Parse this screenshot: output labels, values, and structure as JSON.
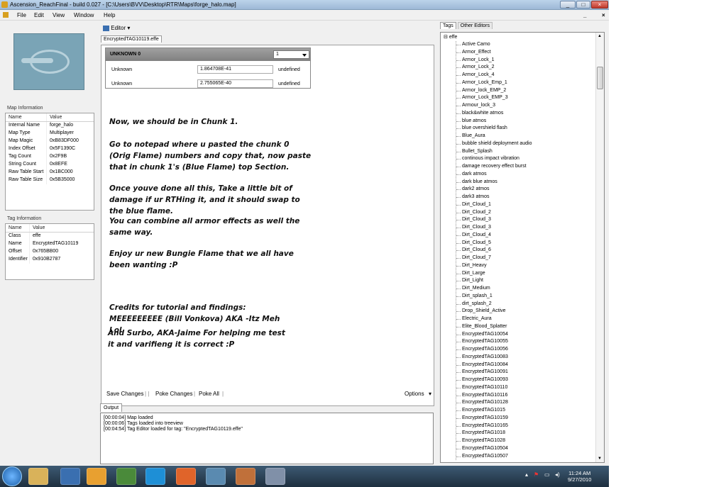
{
  "window": {
    "title": "Ascension_ReachFinal - build 0.027 - [C:\\Users\\BVV\\Desktop\\RTR\\Maps\\forge_halo.map]"
  },
  "menubar": {
    "items": [
      "File",
      "Edit",
      "View",
      "Window",
      "Help"
    ],
    "right_controls": [
      "_",
      "×"
    ]
  },
  "map_info": {
    "group_label": "Map Information",
    "headers": [
      "Name",
      "Value"
    ],
    "rows": [
      [
        "Internal Name",
        "forge_halo"
      ],
      [
        "Map Type",
        "Multiplayer"
      ],
      [
        "Map Magic",
        "0xB83DF000"
      ],
      [
        "Index Offset",
        "0x5F1390C"
      ],
      [
        "Tag Count",
        "0x2F9B"
      ],
      [
        "String Count",
        "0x8EFE"
      ],
      [
        "Raw Table Start",
        "0x1BC000"
      ],
      [
        "Raw Table Size",
        "0x5B35000"
      ]
    ]
  },
  "tag_info": {
    "group_label": "Tag Information",
    "headers": [
      "Name",
      "Value"
    ],
    "rows": [
      [
        "Class",
        "effe"
      ],
      [
        "Name",
        "EncryptedTAG10119"
      ],
      [
        "Offset",
        "0x765BB00"
      ],
      [
        "Identifier",
        "0x910B2787"
      ]
    ]
  },
  "editor": {
    "toolbar_label": "Editor",
    "tab_label": "EncryptedTAG10119.effe",
    "block_title": "UNKNOWN 0",
    "chunk_select": "1",
    "fields": [
      {
        "label": "Unknown",
        "value": "1.864708E-41",
        "type": "undefined"
      },
      {
        "label": "Unknown",
        "value": "2.755065E-40",
        "type": "undefined"
      }
    ],
    "notes": [
      "Now, we should be in Chunk 1.",
      " Go to notepad where u pasted the chunk 0 (Orig Flame) numbers and copy that, now paste that in chunk 1's (Blue Flame) top Section.",
      "Once youve done all this, Take a little bit of damage if ur RTHing it, and it should swap to the blue flame.",
      "You can combine all armor effects as well the same way.",
      "Enjoy ur new Bungie Flame that we all have been wanting :P",
      "Credits for tutorial and findings: MEEEEEEEEE (Bill Vonkova) AKA -Itz Meh Lol",
      "And Surbo, AKA-Jaime For helping me test it and varifieng it is correct :P"
    ],
    "bottom": {
      "save": "Save Changes",
      "poke": "Poke Changes",
      "poke_all": "Poke All",
      "options": "Options"
    }
  },
  "output": {
    "tab_label": "Output",
    "lines": [
      "[00:00:04] Map loaded",
      "[00:00:06] Tags loaded into treeview",
      "[00:04:54] Tag Editor loaded for tag: \"EncryptedTAG10119.effe\""
    ]
  },
  "tags_panel": {
    "tabs": [
      "Tags",
      "Other Editors"
    ],
    "root": "effe",
    "items": [
      "Active Camo",
      "Armor_Effect",
      "Armor_Lock_1",
      "Armor_Lock_2",
      "Armor_Lock_4",
      "Armor_Lock_Emp_1",
      "Armor_lock_EMP_2",
      "Armor_Lock_EMP_3",
      "Armour_lock_3",
      "black&white atmos",
      "blue atmos",
      "blue overshield flash",
      "Blue_Aura",
      "bubble shield deployment audio",
      "Bullet_Splash",
      "continous impact vibration",
      "damage recovery effect burst",
      "dark atmos",
      "dark blue atmos",
      "dark2 atmos",
      "dark3 atmos",
      "Dirt_Cloud_1",
      "Dirt_Cloud_2",
      "Dirt_Cloud_3",
      "Dirt_Cloud_3",
      "Dirt_Cloud_4",
      "Dirt_Cloud_5",
      "Dirt_Cloud_6",
      "Dirt_Cloud_7",
      "Dirt_Heavy",
      "Dirt_Large",
      "Dirt_Light",
      "Dirt_Medium",
      "Dirt_splash_1",
      "dirt_splash_2",
      "Drop_Shield_Active",
      "Electric_Aura",
      "Elite_Blood_Splatter",
      "EncryptedTAG10054",
      "EncryptedTAG10055",
      "EncryptedTAG10056",
      "EncryptedTAG10083",
      "EncryptedTAG10084",
      "EncryptedTAG10091",
      "EncryptedTAG10093",
      "EncryptedTAG10110",
      "EncryptedTAG10116",
      "EncryptedTAG10128",
      "EncryptedTAG1015",
      "EncryptedTAG10159",
      "EncryptedTAG10165",
      "EncryptedTAG1018",
      "EncryptedTAG1028",
      "EncryptedTAG10504",
      "EncryptedTAG10507"
    ]
  },
  "taskbar": {
    "time": "11:24 AM",
    "date": "9/27/2010"
  },
  "colors": {
    "title_bar": "#9db8d6",
    "taskbar": "#1e2f3f",
    "panel_bg": "#f0f0f0"
  }
}
